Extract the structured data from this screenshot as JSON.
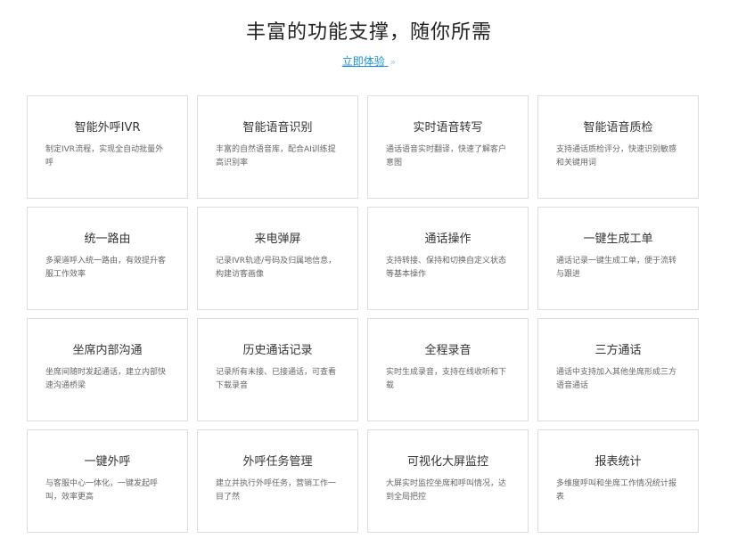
{
  "header": {
    "title": "丰富的功能支撑，随你所需",
    "cta_label": "立即体验",
    "cta_arrow": "»"
  },
  "features": [
    {
      "title": "智能外呼IVR",
      "desc": "制定IVR流程，实现全自动批量外呼"
    },
    {
      "title": "智能语音识别",
      "desc": "丰富的自然语音库，配合AI训练提高识别率"
    },
    {
      "title": "实时语音转写",
      "desc": "通话语音实时翻译，快速了解客户意图"
    },
    {
      "title": "智能语音质检",
      "desc": "支持通话质检评分，快速识别敏感和关键用词"
    },
    {
      "title": "统一路由",
      "desc": "多渠道呼入统一路由，有效提升客服工作效率"
    },
    {
      "title": "来电弹屏",
      "desc": "记录IVR轨迹/号码及归属地信息，构建访客画像"
    },
    {
      "title": "通话操作",
      "desc": "支持转接、保持和切换自定义状态等基本操作"
    },
    {
      "title": "一键生成工单",
      "desc": "通话记录一键生成工单，便于流转与跟进"
    },
    {
      "title": "坐席内部沟通",
      "desc": "坐席间随时发起通话，建立内部快速沟通桥梁"
    },
    {
      "title": "历史通话记录",
      "desc": "记录所有未接、已接通话，可查看下载录音"
    },
    {
      "title": "全程录音",
      "desc": "实时生成录音，支持在线收听和下载"
    },
    {
      "title": "三方通话",
      "desc": "通话中支持加入其他坐席形成三方语音通话"
    },
    {
      "title": "一键外呼",
      "desc": "与客服中心一体化，一键发起呼叫，效率更高"
    },
    {
      "title": "外呼任务管理",
      "desc": "建立并执行外呼任务，营销工作一目了然"
    },
    {
      "title": "可视化大屏监控",
      "desc": "大屏实时监控坐席和呼叫情况，达到全局把控"
    },
    {
      "title": "报表统计",
      "desc": "多维度呼叫和坐席工作情况统计报表"
    }
  ]
}
